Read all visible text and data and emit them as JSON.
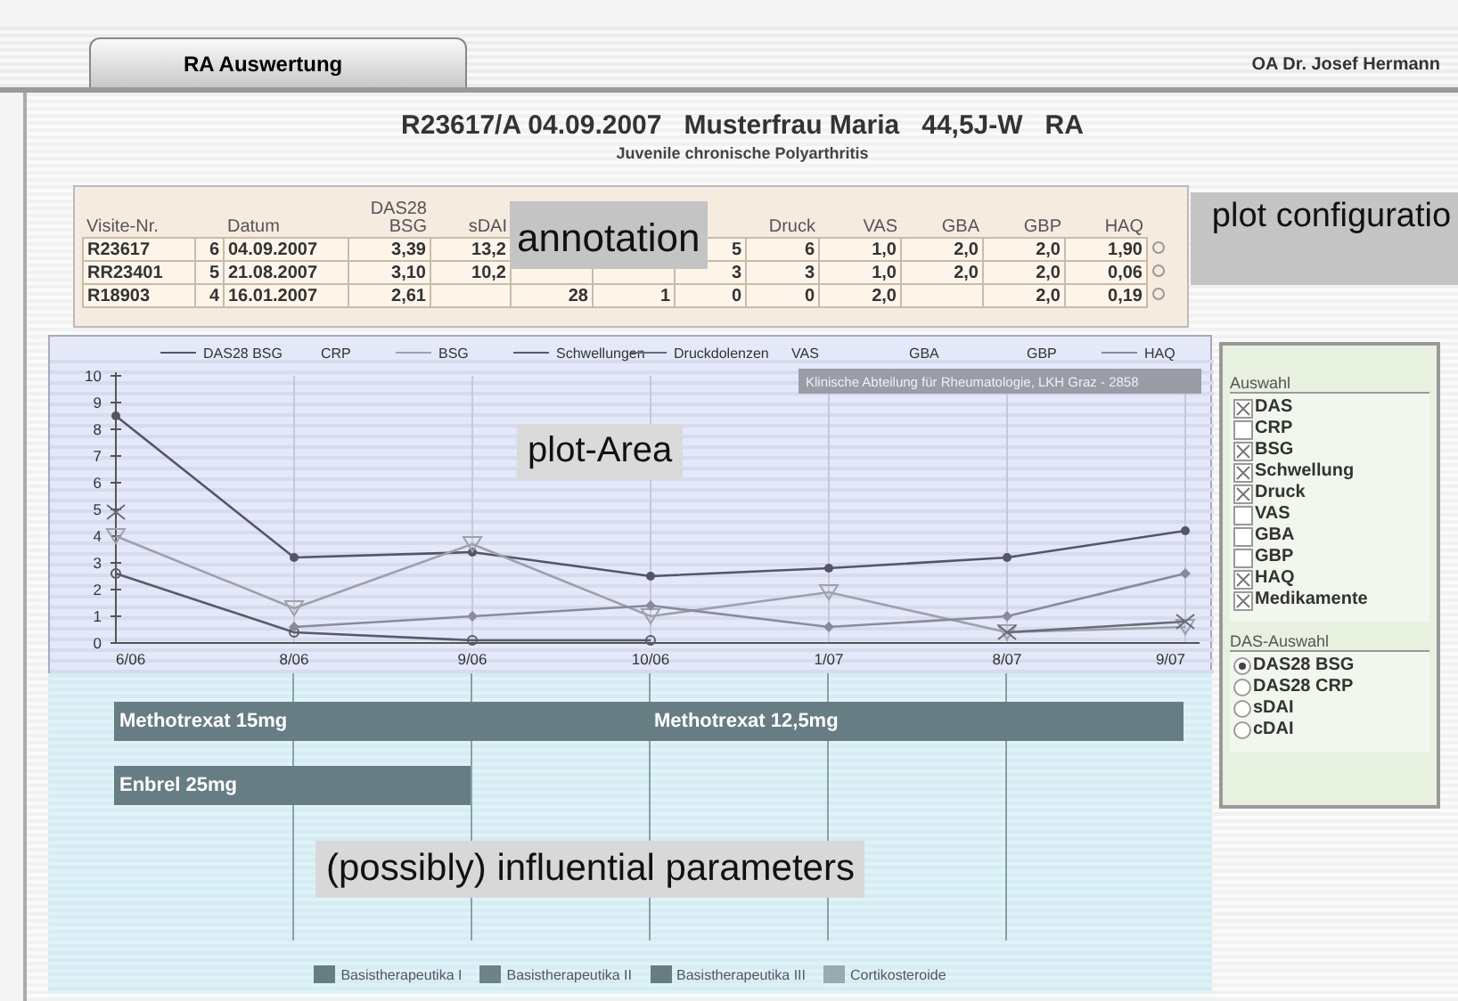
{
  "tabs": [
    {
      "label": "RA Auswertung",
      "selected": true
    }
  ],
  "user": "OA Dr. Josef Hermann",
  "header": {
    "title": "R23617/A 04.09.2007   Musterfrau Maria   44,5J-W   RA",
    "subtitle": "Juvenile chronische Polyarthritis"
  },
  "table": {
    "columns": [
      [
        "Visite-Nr."
      ],
      null,
      [
        "Datum"
      ],
      [
        "DAS28",
        "BSG"
      ],
      [
        "sDAI"
      ],
      null,
      null,
      null,
      [
        "Druck"
      ],
      [
        "VAS"
      ],
      [
        "GBA"
      ],
      [
        "GBP"
      ],
      [
        "HAQ"
      ]
    ],
    "rows": [
      [
        "R23617",
        "6",
        "04.09.2007",
        "3,39",
        "13,2",
        null,
        null,
        "5",
        "6",
        "1,0",
        "2,0",
        "2,0",
        "1,90"
      ],
      [
        "RR23401",
        "5",
        "21.08.2007",
        "3,10",
        "10,2",
        null,
        null,
        "3",
        "3",
        "1,0",
        "2,0",
        "2,0",
        "0,06"
      ],
      [
        "R18903",
        "4",
        "16.01.2007",
        "2,61",
        null,
        "28",
        "1",
        "0",
        "0",
        "2,0",
        null,
        "2,0",
        "0,19"
      ]
    ]
  },
  "chart_data": {
    "type": "line",
    "categories": [
      "6/06",
      "8/06",
      "9/06",
      "10/06",
      "1/07",
      "8/07",
      "9/07"
    ],
    "ylim": [
      0,
      10
    ],
    "yticks": [
      0,
      1,
      2,
      3,
      4,
      5,
      6,
      7,
      8,
      9,
      10
    ],
    "grid": true,
    "legend": "top",
    "annotations": [
      "Klinische Abteilung für Rheumatologie, LKH Graz - 2858"
    ],
    "series": [
      {
        "name": "DAS28 BSG",
        "color": "#555566",
        "marker": "dot",
        "values": [
          8.5,
          3.2,
          3.4,
          2.5,
          2.8,
          3.2,
          4.2
        ]
      },
      {
        "name": "CRP",
        "marker": "none",
        "values": [
          null,
          null,
          null,
          null,
          null,
          null,
          null
        ]
      },
      {
        "name": "BSG",
        "color": "#a0a0aa",
        "marker": "triangle",
        "values": [
          4.0,
          1.3,
          3.7,
          1.0,
          1.9,
          0.4,
          0.6
        ]
      },
      {
        "name": "Schwellungen",
        "color": "#5a5a66",
        "marker": "circle",
        "values": [
          2.6,
          0.4,
          0.1,
          0.1,
          null,
          null,
          null
        ]
      },
      {
        "name": "Druckdolenzen",
        "color": "#6a6a78",
        "marker": "cross",
        "values": [
          4.9,
          null,
          null,
          null,
          null,
          0.4,
          0.8
        ]
      },
      {
        "name": "VAS",
        "marker": "none",
        "values": [
          null,
          null,
          null,
          null,
          null,
          null,
          null
        ]
      },
      {
        "name": "GBA",
        "marker": "none",
        "values": [
          null,
          null,
          null,
          null,
          null,
          null,
          null
        ]
      },
      {
        "name": "GBP",
        "marker": "none",
        "values": [
          null,
          null,
          null,
          null,
          null,
          null,
          null
        ]
      },
      {
        "name": "HAQ",
        "color": "#8a8a9a",
        "marker": "diamond",
        "values": [
          null,
          0.6,
          1.0,
          1.4,
          0.6,
          1.0,
          2.6
        ]
      }
    ]
  },
  "medications": {
    "rows": [
      [
        {
          "label": "Methotrexat 15mg",
          "color": "#677d84"
        },
        {
          "continued": true
        },
        {
          "continued": true
        },
        {
          "label": "Methotrexat 12,5mg",
          "color": "#677d84"
        },
        {
          "continued": true
        },
        {
          "continued": true
        }
      ],
      [
        {
          "label": "Enbrel 25mg",
          "color": "#677d84"
        },
        {
          "continued": true
        },
        null,
        null,
        null,
        null
      ]
    ],
    "legend": [
      {
        "label": "Basistherapeutika I",
        "color": "#677d84"
      },
      {
        "label": "Basistherapeutika II",
        "color": "#6e8389"
      },
      {
        "label": "Basistherapeutika III",
        "color": "#687c83"
      },
      {
        "label": "Cortikosteroide",
        "color": "#9aaab0"
      }
    ]
  },
  "selection": {
    "title": "Auswahl",
    "items": [
      {
        "label": "DAS",
        "checked": true
      },
      {
        "label": "CRP",
        "checked": false
      },
      {
        "label": "BSG",
        "checked": true
      },
      {
        "label": "Schwellung",
        "checked": true
      },
      {
        "label": "Druck",
        "checked": true
      },
      {
        "label": "VAS",
        "checked": false
      },
      {
        "label": "GBA",
        "checked": false
      },
      {
        "label": "GBP",
        "checked": false
      },
      {
        "label": "HAQ",
        "checked": true
      },
      {
        "label": "Medikamente",
        "checked": true
      }
    ]
  },
  "das_selection": {
    "title": "DAS-Auswahl",
    "items": [
      {
        "label": "DAS28 BSG",
        "selected": true
      },
      {
        "label": "DAS28 CRP",
        "selected": false
      },
      {
        "label": "sDAI",
        "selected": false
      },
      {
        "label": "cDAI",
        "selected": false
      }
    ]
  },
  "overlays": [
    {
      "kind": "table",
      "text": "annotation"
    },
    {
      "kind": "config",
      "text": "plot configuratio"
    },
    {
      "kind": "plot",
      "text": "plot-Area"
    },
    {
      "kind": "meds",
      "text": "(possibly) influential parameters"
    }
  ]
}
